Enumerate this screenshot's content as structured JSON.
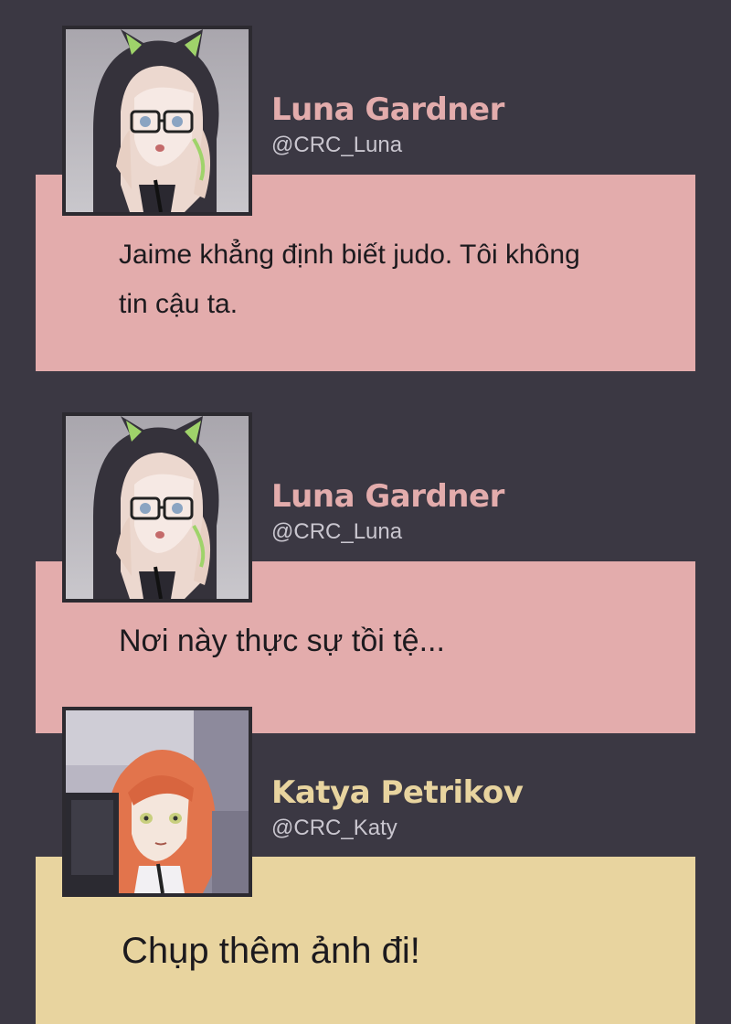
{
  "colors": {
    "background": "#3b3843",
    "luna_name": "#e3acac",
    "luna_bubble": "#e3acac",
    "katya_name": "#e8d49f",
    "katya_bubble": "#e8d49f",
    "handle": "#c9c6cf",
    "message_text": "#1c1a1e"
  },
  "posts": [
    {
      "author": "Luna Gardner",
      "handle": "@CRC_Luna",
      "avatar_icon": "luna-avatar-icon",
      "message_lines": [
        "Jaime khẳng định biết judo. Tôi không",
        "tin cậu ta."
      ]
    },
    {
      "author": "Luna Gardner",
      "handle": "@CRC_Luna",
      "avatar_icon": "luna-avatar-icon",
      "message_lines": [
        "Nơi này thực sự tồi tệ..."
      ]
    },
    {
      "author": "Katya Petrikov",
      "handle": "@CRC_Katy",
      "avatar_icon": "katya-avatar-icon",
      "message_lines": [
        "Chụp thêm ảnh đi!"
      ]
    }
  ]
}
